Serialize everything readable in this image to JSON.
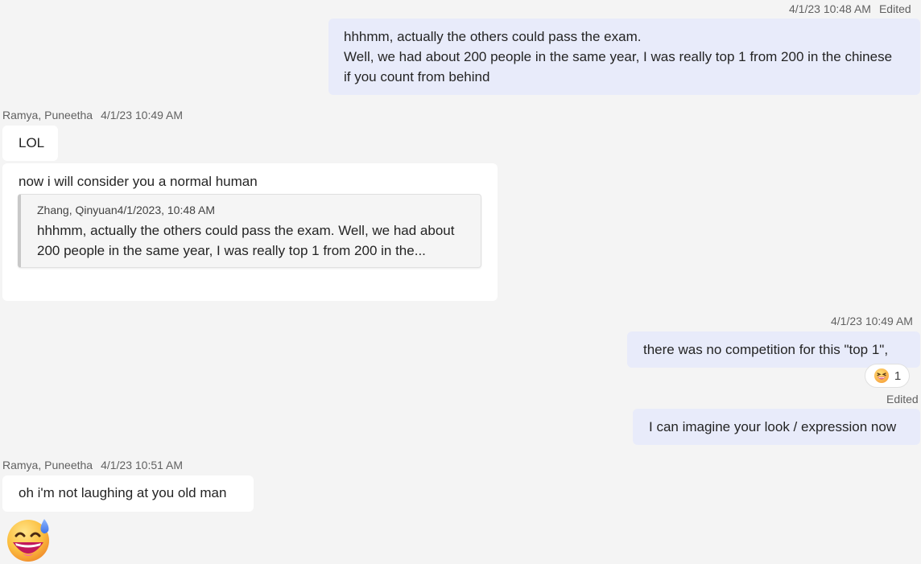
{
  "messages": {
    "m1": {
      "timestamp": "4/1/23 10:48 AM",
      "edited": "Edited",
      "lines": [
        "hhhmm, actually the others could pass the exam.",
        "Well, we had about 200 people in the same year, I was really top 1 from 200 in the chinese",
        "if you count from behind"
      ]
    },
    "m2": {
      "sender": "Ramya, Puneetha",
      "timestamp": "4/1/23 10:49 AM",
      "text": "LOL"
    },
    "m3": {
      "text": "now i will consider you a normal human",
      "quote": {
        "sender": "Zhang, Qinyuan",
        "timestamp": "4/1/2023, 10:48 AM",
        "lines": [
          "hhhmm, actually the others could pass the exam. Well, we had about",
          "200 people in the same year, I was really top 1 from 200 in the..."
        ]
      }
    },
    "m4": {
      "timestamp": "4/1/23 10:49 AM",
      "text": "there was no competition for this \"top 1\",",
      "reaction": {
        "icon": "laughing-face-emoji",
        "count": "1"
      }
    },
    "m5": {
      "edited": "Edited",
      "text": "I can imagine your look / expression now"
    },
    "m6": {
      "sender": "Ramya, Puneetha",
      "timestamp": "4/1/23 10:51 AM",
      "text": "oh i'm not laughing at you old man"
    },
    "m7": {
      "icon": "grinning-sweat-emoji"
    }
  },
  "colors": {
    "background": "#f4f4f4",
    "own_bubble": "#e8ebfa",
    "other_bubble": "#ffffff",
    "meta_text": "#616161"
  }
}
